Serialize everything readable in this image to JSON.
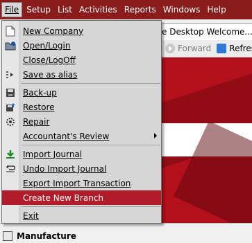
{
  "menubar": {
    "items": [
      {
        "label": "File",
        "active": true
      },
      {
        "label": "Setup"
      },
      {
        "label": "List"
      },
      {
        "label": "Activities"
      },
      {
        "label": "Reports"
      },
      {
        "label": "Windows"
      },
      {
        "label": "Help"
      }
    ]
  },
  "background": {
    "tab_title": "e Desktop Welcome...",
    "forward_label": "Forward",
    "refresh_label": "Refresh",
    "bottom_label": "Manufacture"
  },
  "file_menu": {
    "items": [
      {
        "label": "New Company",
        "icon": "new-document-icon"
      },
      {
        "label": "Open/Login",
        "icon": "open-folder-icon"
      },
      {
        "label": "Close/LogOff",
        "icon": ""
      },
      {
        "label": "Save as alias",
        "icon": "save-alias-icon"
      },
      {
        "label": "Back-up",
        "icon": "backup-disk-icon"
      },
      {
        "label": "Restore",
        "icon": "restore-disk-icon"
      },
      {
        "label": "Repair",
        "icon": "repair-gear-icon"
      },
      {
        "label": "Accountant's Review",
        "icon": "",
        "submenu": true
      },
      {
        "label": "Import Journal",
        "icon": "import-arrow-icon"
      },
      {
        "label": "Undo Import Journal",
        "icon": "undo-import-icon"
      },
      {
        "label": "Export Import Transaction",
        "icon": ""
      },
      {
        "label": "Create New Branch",
        "icon": "",
        "highlighted": true
      },
      {
        "label": "Exit",
        "icon": ""
      }
    ]
  },
  "colors": {
    "menubar_bg": "#8b1c1c",
    "highlight": "#b01c2a",
    "menu_bg": "#d6d6d6"
  }
}
